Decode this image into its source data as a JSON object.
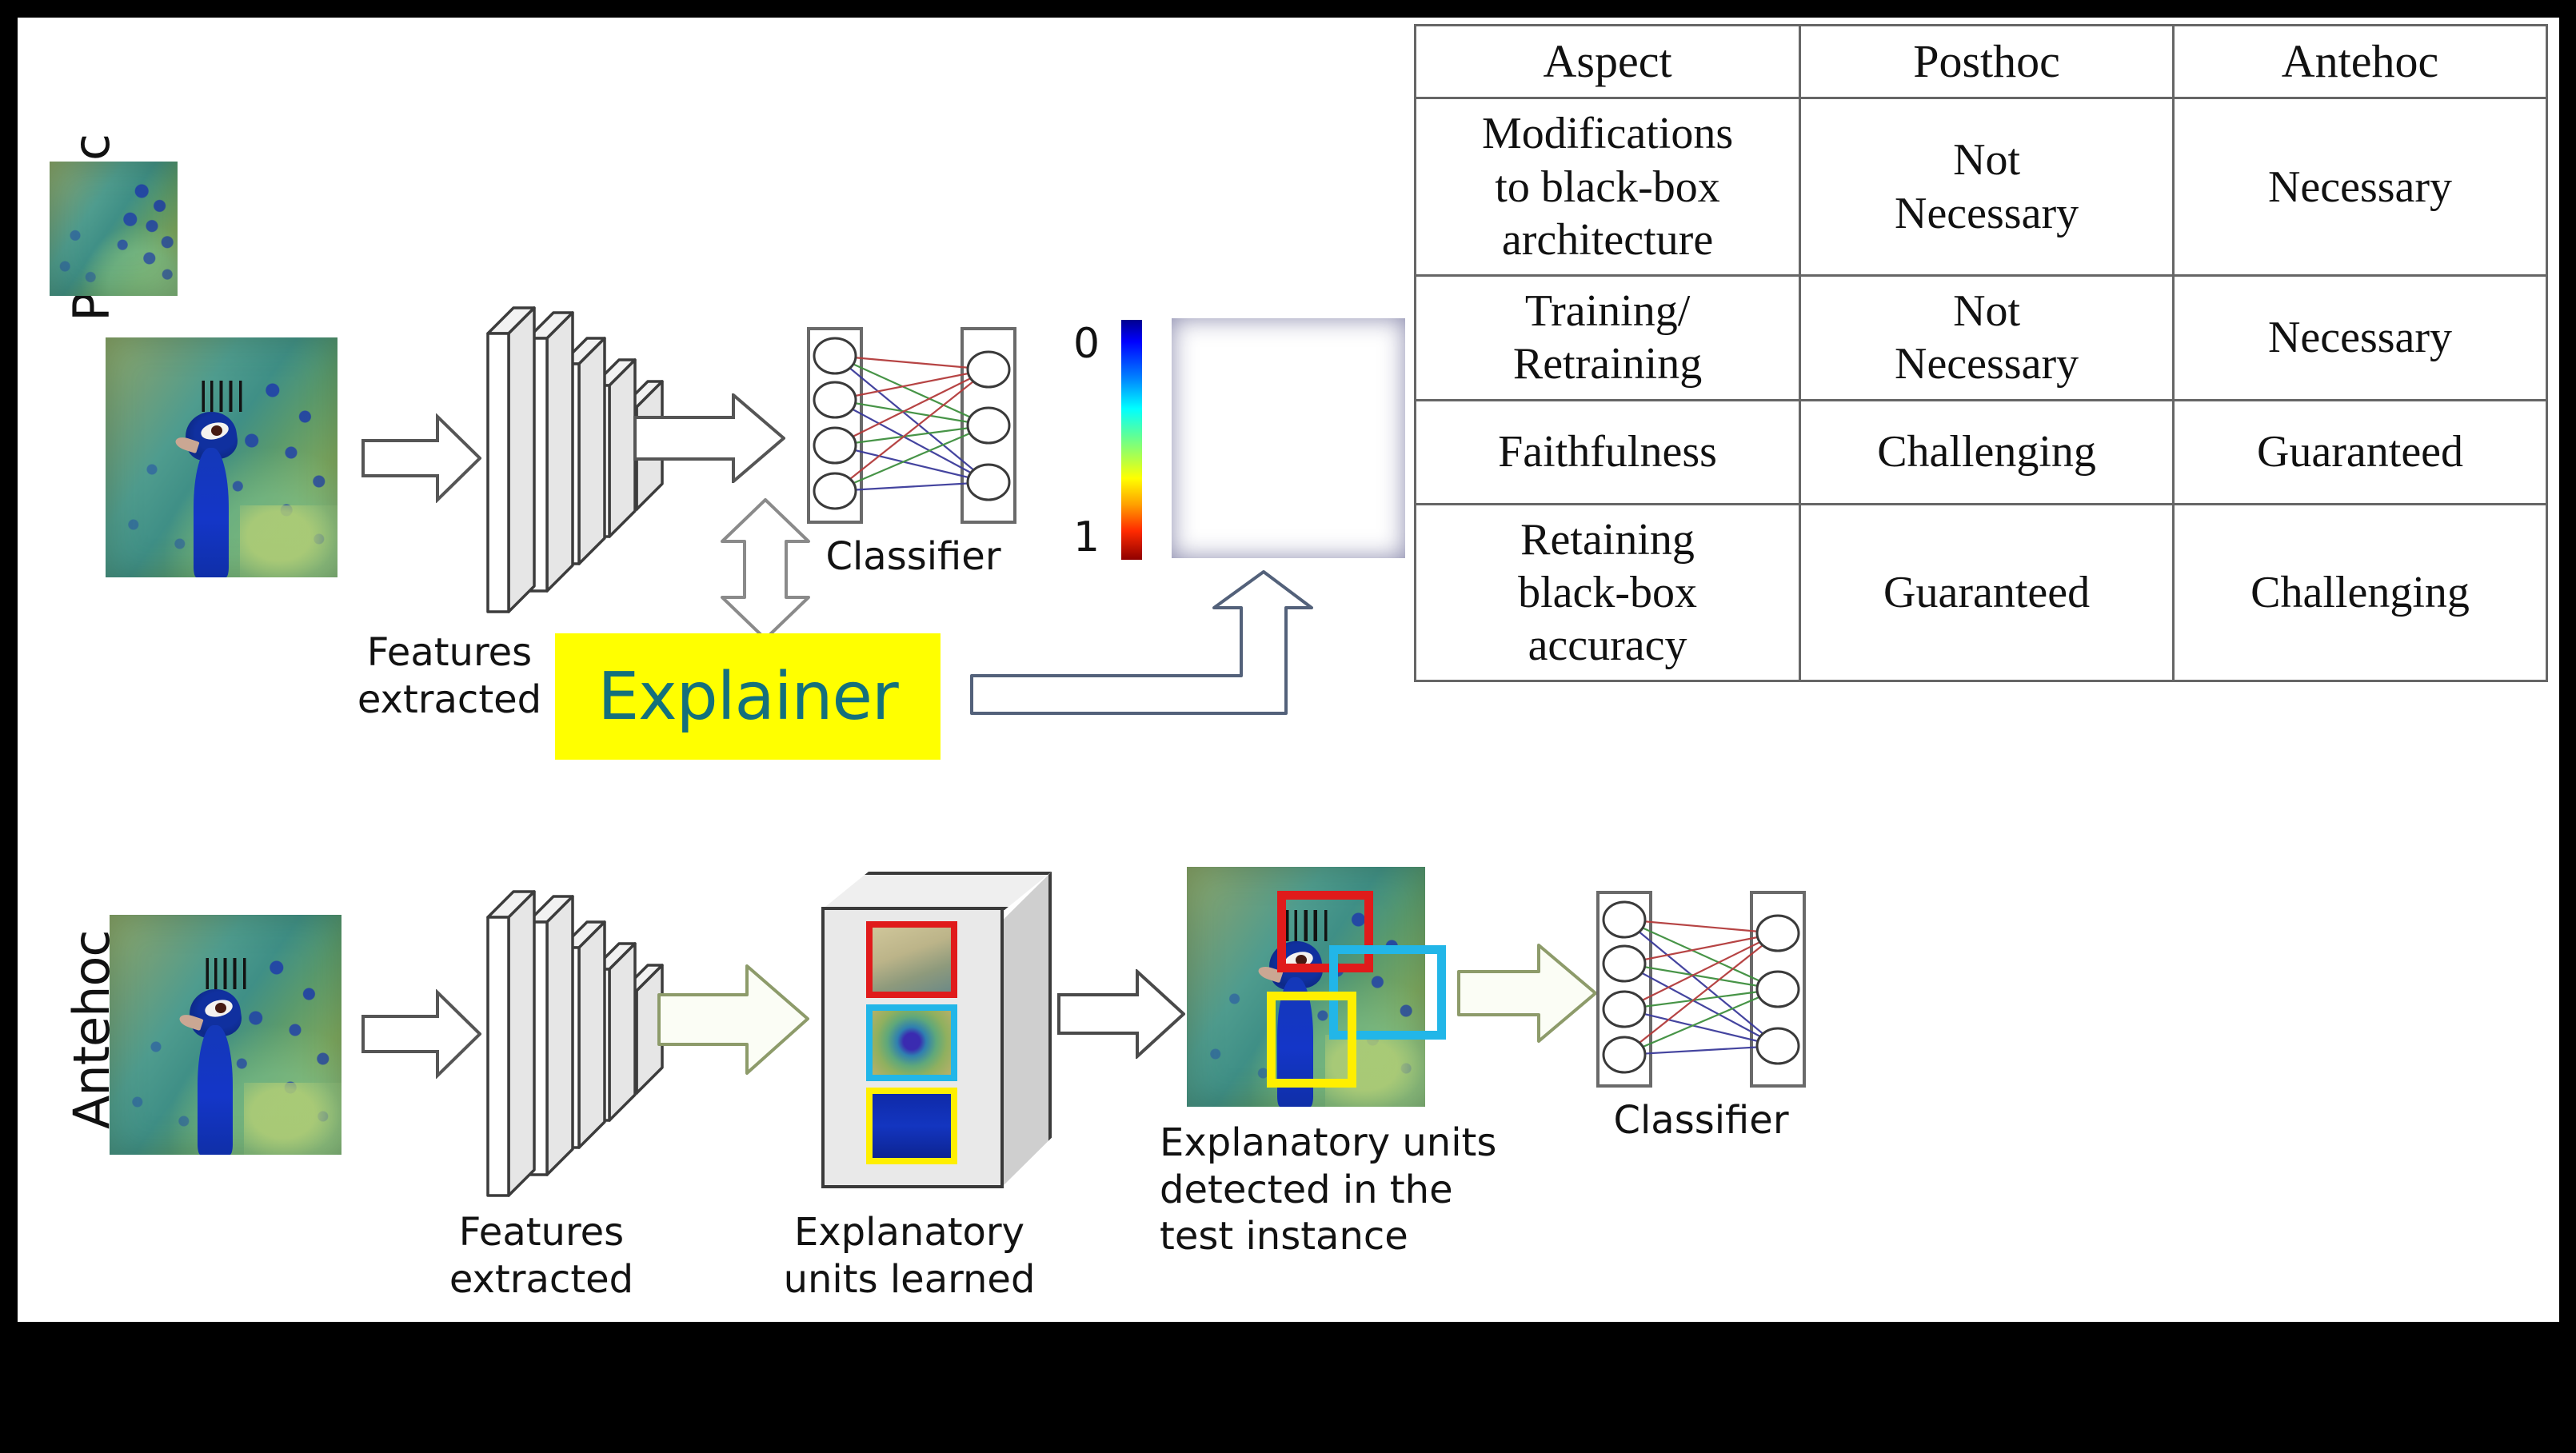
{
  "rows": {
    "posthoc": {
      "side_label": "Posthoc",
      "input_image_alt": "peacock-photo",
      "features_caption": "Features\nextracted",
      "classifier_label": "Classifier",
      "explainer_label": "Explainer",
      "explainer_bg": "#ffff00",
      "explainer_fg": "#14707c",
      "colorbar": {
        "top": "0",
        "bottom": "1"
      },
      "heatmap_alt": "saliency-heatmap"
    },
    "antehoc": {
      "side_label": "Antehoc",
      "input_image_alt": "peacock-photo",
      "features_caption": "Features\nextracted",
      "units_learned_caption": "Explanatory\nunits learned",
      "units_detected_caption": "Explanatory units\ndetected in the\ntest instance",
      "classifier_label": "Classifier",
      "unit_colors": [
        "#e01b1b",
        "#22b6e8",
        "#ffef00"
      ]
    }
  },
  "table": {
    "headers": [
      "Aspect",
      "Posthoc",
      "Antehoc"
    ],
    "rows": [
      {
        "aspect": "Modifications\nto black-box\narchitecture",
        "posthoc": "Not\nNecessary",
        "antehoc": "Necessary"
      },
      {
        "aspect": "Training/\nRetraining",
        "posthoc": "Not\nNecessary",
        "antehoc": "Necessary"
      },
      {
        "aspect": "Faithfulness",
        "posthoc": "Challenging",
        "antehoc": "Guaranteed"
      },
      {
        "aspect": "Retaining\nblack-box\naccuracy",
        "posthoc": "Guaranteed",
        "antehoc": "Challenging"
      }
    ]
  }
}
